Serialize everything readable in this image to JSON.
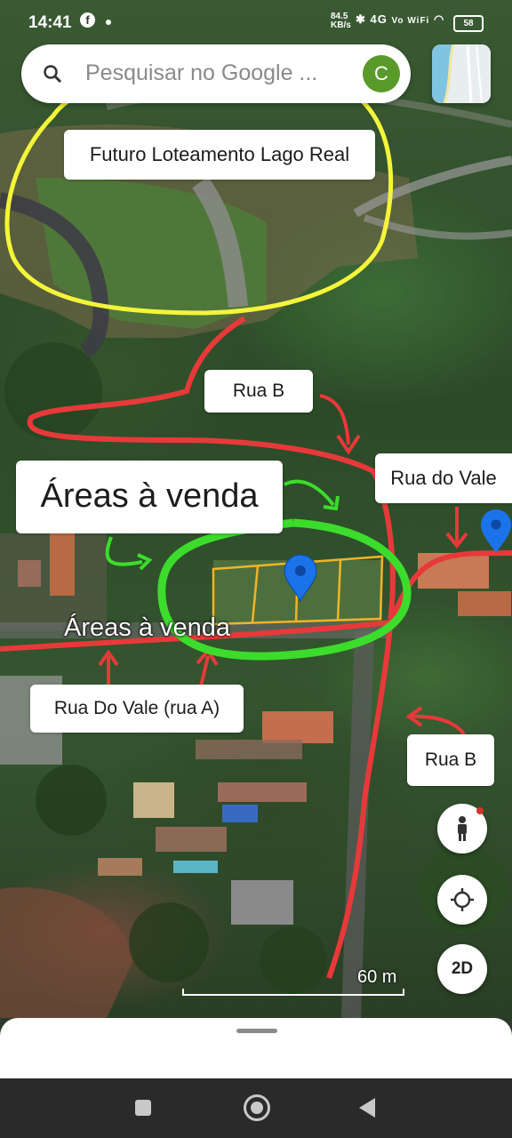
{
  "status_bar": {
    "time": "14:41",
    "speed": "84.5\nKB/s",
    "signal": "4G",
    "network": "Vo WiFi",
    "battery": "58"
  },
  "search": {
    "placeholder": "Pesquisar no Google ...",
    "avatar_letter": "C"
  },
  "annotations": {
    "future_area": "Futuro Loteamento Lago Real",
    "rua_b_top": "Rua B",
    "areas_callout": "Áreas à venda",
    "rua_do_vale": "Rua do Vale",
    "rua_do_vale_a": "Rua Do Vale (rua A)",
    "rua_b_bottom": "Rua B"
  },
  "map": {
    "place_label": "Áreas à venda",
    "scale_label": "60 m",
    "mode_button": "2D"
  },
  "colors": {
    "yellow_annotation": "#f4f53a",
    "red_annotation": "#e8393a",
    "green_annotation": "#3cdc2c",
    "pin": "#1a73e8",
    "lot_outline": "#f0b429"
  }
}
